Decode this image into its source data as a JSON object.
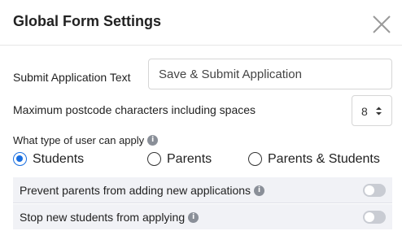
{
  "dialog": {
    "title": "Global Form Settings",
    "close_icon": "close-x-icon"
  },
  "submit_text": {
    "label": "Submit Application Text",
    "value": "Save & Submit Application"
  },
  "postcode": {
    "label": "Maximum postcode characters including spaces",
    "value": "8"
  },
  "user_type": {
    "label": "What type of user can apply",
    "info_icon": "info-icon",
    "options": [
      {
        "label": "Students",
        "selected": true
      },
      {
        "label": "Parents",
        "selected": false
      },
      {
        "label": "Parents & Students",
        "selected": false
      }
    ]
  },
  "toggles": [
    {
      "label": "Prevent parents from adding new applications",
      "on": false
    },
    {
      "label": "Stop new students from applying",
      "on": false
    }
  ],
  "colors": {
    "accent": "#1a6fe0",
    "toggle_off": "#c9ccd3",
    "row_bg": "#f1f2f6"
  }
}
